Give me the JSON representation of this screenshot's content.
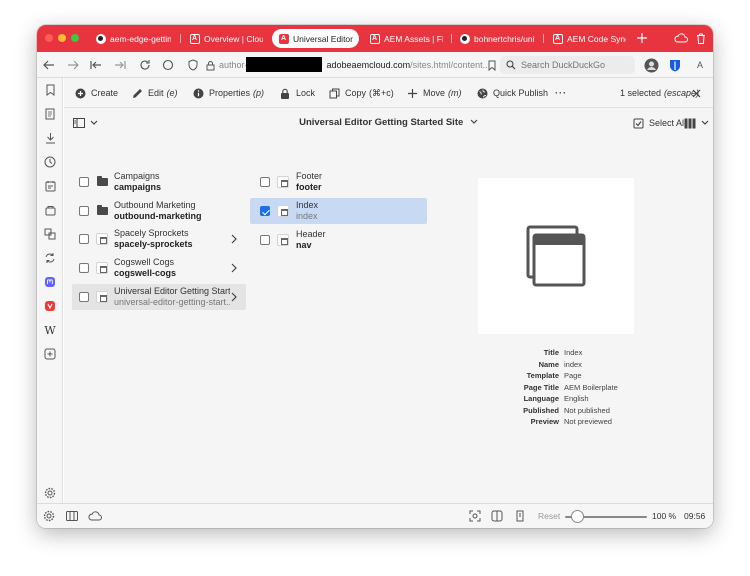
{
  "tabs": [
    {
      "label": "aem-edge-getting",
      "icon": "github-icon"
    },
    {
      "label": "Overview | Cloud M",
      "icon": "adobe-icon"
    },
    {
      "label": "Universal Editor Ge",
      "icon": "adobe-icon",
      "active": true
    },
    {
      "label": "AEM Assets | Files",
      "icon": "adobe-icon"
    },
    {
      "label": "bohnertchris/unive",
      "icon": "github-icon"
    },
    {
      "label": "AEM Code Sync re",
      "icon": "adobe-icon"
    }
  ],
  "address": {
    "url_prefix": "author-",
    "url_domain": "adobeaemcloud.com",
    "url_path": "/sites.html/content...",
    "search_placeholder": "Search DuckDuckGo"
  },
  "toolbar": {
    "create": "Create",
    "edit": "Edit",
    "edit_shortcut": "(e)",
    "properties": "Properties",
    "properties_shortcut": "(p)",
    "lock": "Lock",
    "copy": "Copy",
    "copy_shortcut": "(⌘+c)",
    "move": "Move",
    "move_shortcut": "(m)",
    "quick_publish": "Quick Publish",
    "more": "···",
    "selection_count": "1 selected",
    "selection_hint": "(escape)"
  },
  "titlebar": {
    "site_title": "Universal Editor Getting Started Site",
    "select_all": "Select All"
  },
  "column1": [
    {
      "title": "Campaigns",
      "name": "campaigns",
      "type": "folder"
    },
    {
      "title": "Outbound Marketing",
      "name": "outbound-marketing",
      "type": "folder"
    },
    {
      "title": "Spacely Sprockets",
      "name": "spacely-sprockets",
      "type": "page",
      "has_children": true
    },
    {
      "title": "Cogswell Cogs",
      "name": "cogswell-cogs",
      "type": "page",
      "has_children": true
    },
    {
      "title": "Universal Editor Getting Start...",
      "name": "universal-editor-getting-start...",
      "type": "page",
      "has_children": true,
      "highlighted": true
    }
  ],
  "column2": [
    {
      "title": "Footer",
      "name": "footer"
    },
    {
      "title": "Index",
      "name": "index",
      "selected": true
    },
    {
      "title": "Header",
      "name": "nav"
    }
  ],
  "details": [
    {
      "label": "Title",
      "value": "Index"
    },
    {
      "label": "Name",
      "value": "index"
    },
    {
      "label": "Template",
      "value": "Page"
    },
    {
      "label": "Page Title",
      "value": "AEM Boilerplate"
    },
    {
      "label": "Language",
      "value": "English"
    },
    {
      "label": "Published",
      "value": "Not published"
    },
    {
      "label": "Preview",
      "value": "Not previewed"
    }
  ],
  "statusbar": {
    "reset": "Reset",
    "zoom": "100 %",
    "zoom_fraction": 0.15,
    "time": "09:56"
  },
  "colors": {
    "tabbar": "#e7343f",
    "selection": "#c8daf3",
    "checkbox": "#1e6fe8"
  }
}
